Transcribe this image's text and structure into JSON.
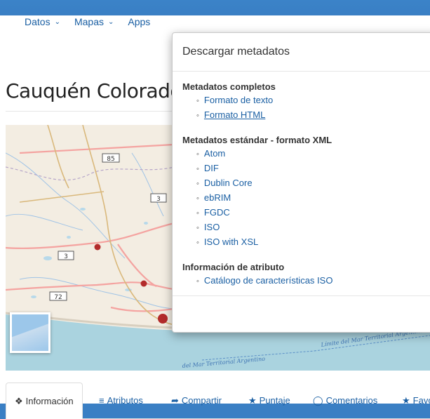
{
  "nav": {
    "items": [
      {
        "label": "Datos"
      },
      {
        "label": "Mapas"
      },
      {
        "label": "Apps"
      }
    ]
  },
  "page_title": "Cauquén Colorado",
  "map": {
    "road_labels": [
      "85",
      "3",
      "3",
      "72"
    ],
    "sea_labels": [
      "Límite del Mar Territorial Argentino",
      "del Mar Territorial Argentino"
    ]
  },
  "tabs": [
    {
      "label": "Información",
      "icon": "info-circle-icon"
    },
    {
      "label": "Atributos",
      "icon": "list-icon"
    },
    {
      "label": "Compartir",
      "icon": "share-arrow-icon"
    },
    {
      "label": "Puntaje",
      "icon": "star-icon"
    },
    {
      "label": "Comentarios",
      "icon": "comment-icon"
    },
    {
      "label": "Favo",
      "icon": "star-icon"
    }
  ],
  "modal": {
    "title": "Descargar metadatos",
    "groups": [
      {
        "heading": "Metadatos completos",
        "links": [
          "Formato de texto",
          "Formato HTML"
        ]
      },
      {
        "heading": "Metadatos estándar - formato XML",
        "links": [
          "Atom",
          "DIF",
          "Dublin Core",
          "ebRIM",
          "FGDC",
          "ISO",
          "ISO with XSL"
        ]
      },
      {
        "heading": "Información de atributo",
        "links": [
          "Catálogo de características ISO"
        ]
      }
    ]
  },
  "colors": {
    "link": "#1a5fa3",
    "header_blue": "#3a7fc4",
    "map_land": "#f3ede2",
    "map_sea": "#aad3df",
    "point": "#b32b2b"
  }
}
